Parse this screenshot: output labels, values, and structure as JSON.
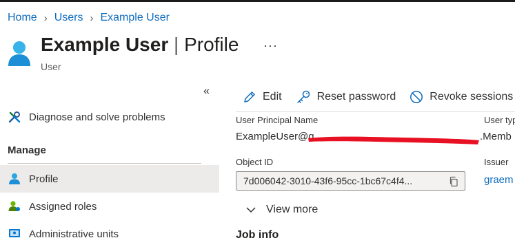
{
  "breadcrumb": [
    "Home",
    "Users",
    "Example User"
  ],
  "header": {
    "title": "Example User",
    "title_separator": "|",
    "title_section": "Profile",
    "more_label": "···",
    "subtitle": "User"
  },
  "sidebar": {
    "collapse_label": "«",
    "diagnose_label": "Diagnose and solve problems",
    "section_manage": "Manage",
    "items": [
      {
        "label": "Profile",
        "icon": "user-icon",
        "selected": true
      },
      {
        "label": "Assigned roles",
        "icon": "user-roles-icon",
        "selected": false
      },
      {
        "label": "Administrative units",
        "icon": "admin-units-icon",
        "selected": false
      }
    ]
  },
  "toolbar": {
    "edit_label": "Edit",
    "reset_label": "Reset password",
    "revoke_label": "Revoke sessions"
  },
  "properties": {
    "upn_label": "User Principal Name",
    "upn_value": "ExampleUser@g",
    "user_type_label": "User typ",
    "user_type_value": ".Memb",
    "object_id_label": "Object ID",
    "object_id_value": "7d006042-3010-43f6-95cc-1bc67c4f4...",
    "issuer_label": "Issuer",
    "issuer_value": "graem"
  },
  "view_more_label": "View more",
  "job_info_heading": "Job info",
  "colors": {
    "accent": "#0f6cbd",
    "redaction": "#e81123",
    "selected_bg": "#edebe9"
  }
}
